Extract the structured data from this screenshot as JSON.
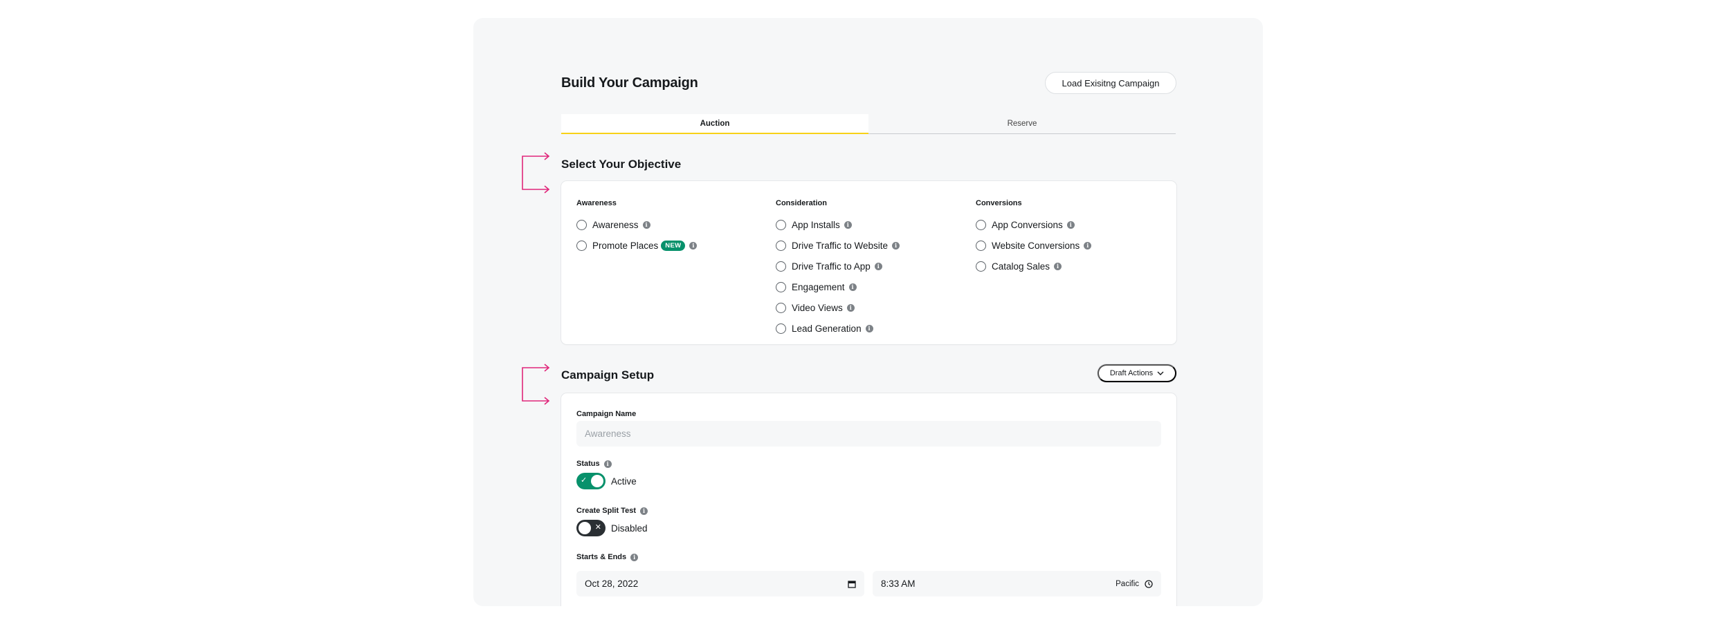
{
  "header": {
    "title": "Build Your Campaign",
    "load_button": "Load Exisitng Campaign"
  },
  "tabs": [
    {
      "label": "Auction",
      "active": true
    },
    {
      "label": "Reserve",
      "active": false
    }
  ],
  "objective": {
    "title": "Select Your Objective",
    "columns": [
      {
        "heading": "Awareness",
        "options": [
          {
            "label": "Awareness"
          },
          {
            "label": "Promote Places",
            "badge": "NEW"
          }
        ]
      },
      {
        "heading": "Consideration",
        "options": [
          {
            "label": "App Installs"
          },
          {
            "label": "Drive Traffic to Website"
          },
          {
            "label": "Drive Traffic to App"
          },
          {
            "label": "Engagement"
          },
          {
            "label": "Video Views"
          },
          {
            "label": "Lead Generation"
          }
        ]
      },
      {
        "heading": "Conversions",
        "options": [
          {
            "label": "App Conversions"
          },
          {
            "label": "Website Conversions"
          },
          {
            "label": "Catalog Sales"
          }
        ]
      }
    ]
  },
  "setup": {
    "title": "Campaign Setup",
    "draft_actions": "Draft Actions",
    "campaign_name_label": "Campaign Name",
    "campaign_name_placeholder": "Awareness",
    "status_label": "Status",
    "status_value": "Active",
    "split_test_label": "Create Split Test",
    "split_test_value": "Disabled",
    "starts_ends_label": "Starts & Ends",
    "start_date": "Oct 28, 2022",
    "start_time": "8:33 AM",
    "timezone": "Pacific"
  },
  "icons": {
    "info": "info-icon",
    "calendar": "calendar-icon",
    "clock": "clock-icon",
    "chevron": "chevron-down-icon"
  },
  "colors": {
    "accent_tab": "#f7d117",
    "toggle_on": "#07916b",
    "badge": "#07916b",
    "arrow": "#e0267a"
  }
}
